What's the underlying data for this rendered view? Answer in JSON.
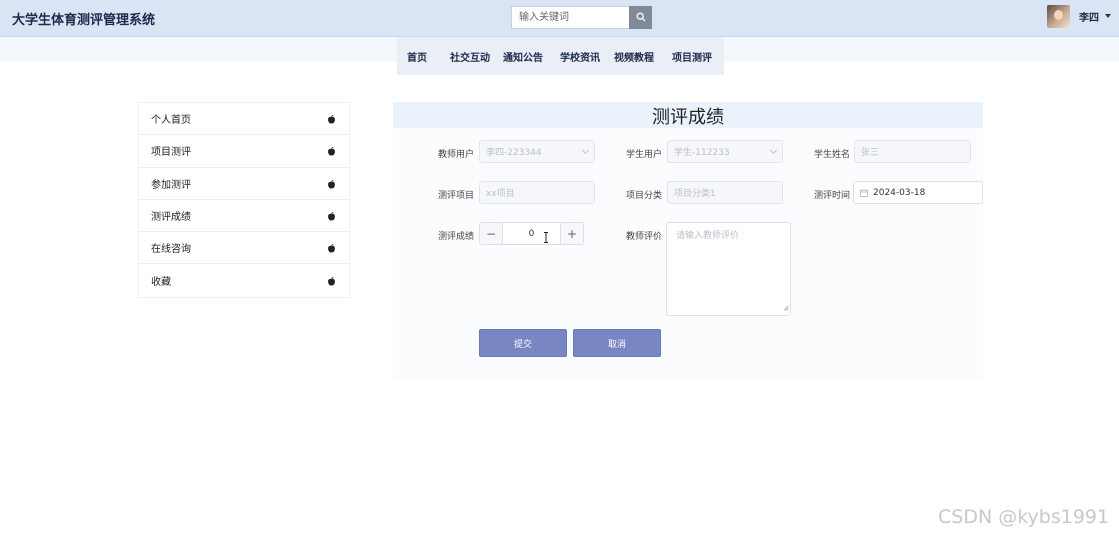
{
  "app": {
    "title": "大学生体育测评管理系统"
  },
  "search": {
    "placeholder": "输入关键词"
  },
  "user": {
    "name": "李四"
  },
  "nav": {
    "items": [
      "首页",
      "社交互动",
      "通知公告",
      "学校资讯",
      "视频教程",
      "项目测评"
    ]
  },
  "sidebar": {
    "items": [
      "个人首页",
      "项目测评",
      "参加测评",
      "测评成绩",
      "在线咨询",
      "收藏"
    ]
  },
  "form": {
    "title": "测评成绩",
    "teacher_user": {
      "label": "教师用户",
      "value": "李四-223344"
    },
    "student_user": {
      "label": "学生用户",
      "value": "学生-112233"
    },
    "student_name": {
      "label": "学生姓名",
      "value": "张三"
    },
    "eval_project": {
      "label": "测评项目",
      "value": "xx项目"
    },
    "project_category": {
      "label": "项目分类",
      "value": "项目分类1"
    },
    "eval_time": {
      "label": "测评时间",
      "value": "2024-03-18"
    },
    "eval_score": {
      "label": "测评成绩",
      "value": "0"
    },
    "teacher_comment": {
      "label": "教师评价",
      "placeholder": "请输入教师评价"
    },
    "submit_label": "提交",
    "cancel_label": "取消"
  },
  "watermark": "CSDN @kybs1991",
  "colors": {
    "header_bg": "#d9e4f5",
    "button": "#7887c2",
    "search_btn": "#808a99"
  }
}
